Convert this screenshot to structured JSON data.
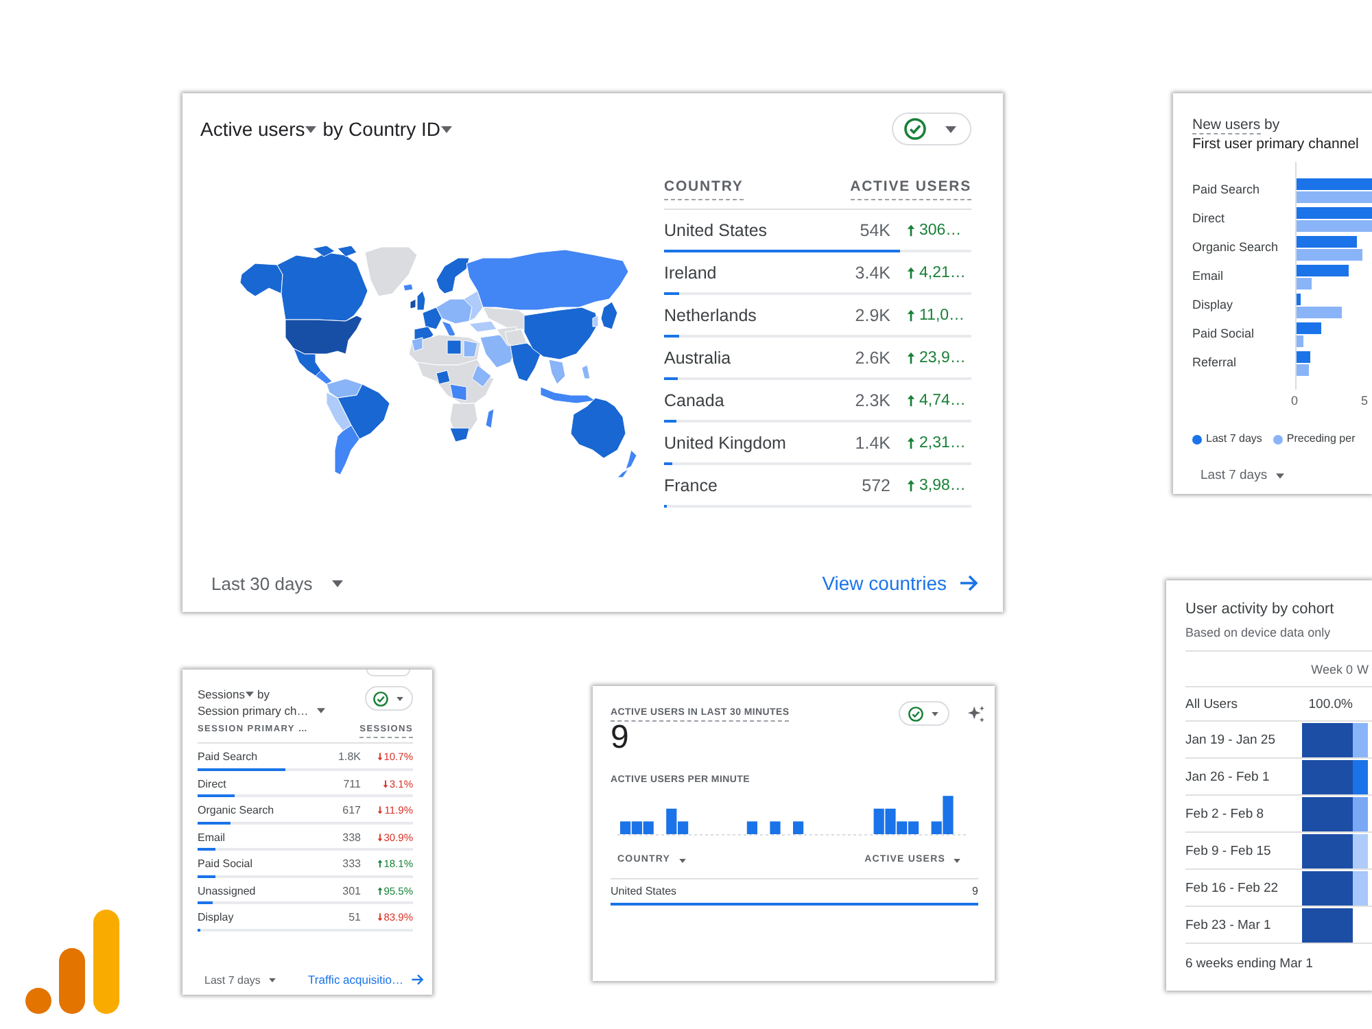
{
  "main_card": {
    "metric": "Active users",
    "joiner": "by",
    "dimension": "Country ID",
    "columns": [
      "COUNTRY",
      "ACTIVE USERS"
    ],
    "rows": [
      {
        "country": "United States",
        "value": "54K",
        "change": "306…",
        "kind": "up",
        "level": 0.77
      },
      {
        "country": "Ireland",
        "value": "3.4K",
        "change": "4,21…",
        "kind": "up",
        "level": 0.05
      },
      {
        "country": "Netherlands",
        "value": "2.9K",
        "change": "11,0…",
        "kind": "up",
        "level": 0.05
      },
      {
        "country": "Australia",
        "value": "2.6K",
        "change": "23,9…",
        "kind": "up",
        "level": 0.045
      },
      {
        "country": "Canada",
        "value": "2.3K",
        "change": "4,74…",
        "kind": "up",
        "level": 0.04
      },
      {
        "country": "United Kingdom",
        "value": "1.4K",
        "change": "2,31…",
        "kind": "up",
        "level": 0.025
      },
      {
        "country": "France",
        "value": "572",
        "change": "3,98…",
        "kind": "up",
        "level": 0.008
      }
    ],
    "date_range": "Last 30 days",
    "link": "View countries"
  },
  "new_users_card": {
    "metric": "New users",
    "joiner": "by",
    "dimension": "First user primary channel",
    "categories": [
      "Paid Search",
      "Direct",
      "Organic Search",
      "Email",
      "Display",
      "Paid Social",
      "Referral"
    ],
    "axis_ticks": [
      "0",
      "5"
    ],
    "legend": [
      {
        "name": "Last 7 days",
        "color": "#1a73e8"
      },
      {
        "name": "Preceding per",
        "color": "#8ab4f8"
      }
    ],
    "date_range": "Last 7 days"
  },
  "sessions_card": {
    "metric": "Sessions",
    "joiner": "by",
    "dimension": "Session primary ch…",
    "columns": [
      "SESSION PRIMARY …",
      "SESSIONS"
    ],
    "rows": [
      {
        "channel": "Paid Search",
        "value": "1.8K",
        "change": "10.7%",
        "kind": "down",
        "level": 0.41
      },
      {
        "channel": "Direct",
        "value": "711",
        "change": "3.1%",
        "kind": "down",
        "level": 0.17
      },
      {
        "channel": "Organic Search",
        "value": "617",
        "change": "11.9%",
        "kind": "down",
        "level": 0.15
      },
      {
        "channel": "Email",
        "value": "338",
        "change": "30.9%",
        "kind": "down",
        "level": 0.08
      },
      {
        "channel": "Paid Social",
        "value": "333",
        "change": "18.1%",
        "kind": "up",
        "level": 0.08
      },
      {
        "channel": "Unassigned",
        "value": "301",
        "change": "95.5%",
        "kind": "up",
        "level": 0.07
      },
      {
        "channel": "Display",
        "value": "51",
        "change": "83.9%",
        "kind": "down",
        "level": 0.01
      }
    ],
    "date_range": "Last 7 days",
    "link": "Traffic acquisitio…"
  },
  "realtime_card": {
    "title": "ACTIVE USERS IN LAST 30 MINUTES",
    "count": "9",
    "chart_title": "ACTIVE USERS PER MINUTE",
    "columns": [
      "COUNTRY",
      "ACTIVE USERS"
    ],
    "rows": [
      {
        "country": "United States",
        "value": "9",
        "level": 1
      }
    ]
  },
  "cohort_card": {
    "title": "User activity by cohort",
    "subtitle": "Based on device data only",
    "columns": [
      "Week 0",
      "W"
    ],
    "all_users": {
      "label": "All Users",
      "values": [
        "100.0%"
      ]
    },
    "rows": [
      {
        "label": "Jan 19 - Jan 25",
        "cells": [
          {
            "color": "#1c4ea6"
          },
          {
            "color": "#8ab4f8"
          }
        ]
      },
      {
        "label": "Jan 26 - Feb 1",
        "cells": [
          {
            "color": "#1c4ea6"
          },
          {
            "color": "#1a73e8"
          }
        ]
      },
      {
        "label": "Feb 2 - Feb 8",
        "cells": [
          {
            "color": "#1c4ea6"
          },
          {
            "color": "#7aa8f5"
          }
        ]
      },
      {
        "label": "Feb 9 - Feb 15",
        "cells": [
          {
            "color": "#1c4ea6"
          },
          {
            "color": "#aecbfa"
          }
        ]
      },
      {
        "label": "Feb 16 - Feb 22",
        "cells": [
          {
            "color": "#1c4ea6"
          },
          {
            "color": "#a8c7fa"
          }
        ]
      },
      {
        "label": "Feb 23 - Mar 1",
        "cells": [
          {
            "color": "#1c4ea6"
          }
        ]
      }
    ],
    "footer": "6 weeks ending Mar 1"
  }
}
